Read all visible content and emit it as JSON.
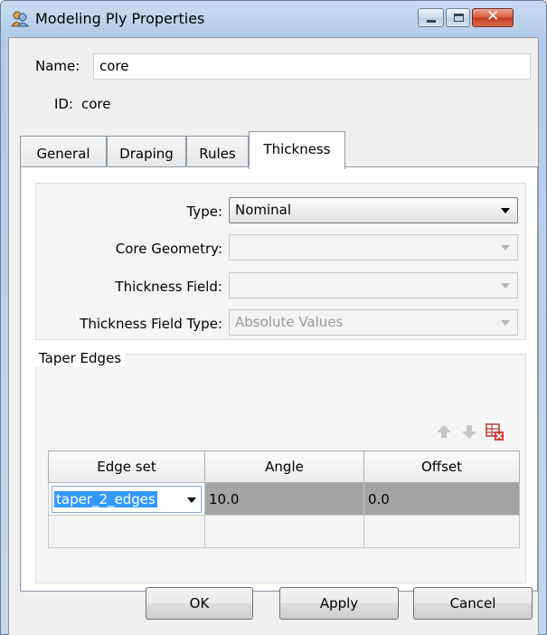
{
  "window": {
    "title": "Modeling Ply Properties"
  },
  "form": {
    "name_label": "Name:",
    "name_value": "core",
    "id_label": "ID:",
    "id_value": "core"
  },
  "tabs": [
    {
      "label": "General",
      "active": false
    },
    {
      "label": "Draping",
      "active": false
    },
    {
      "label": "Rules",
      "active": false
    },
    {
      "label": "Thickness",
      "active": true
    }
  ],
  "thickness": {
    "fields": [
      {
        "label": "Type:",
        "value": "Nominal",
        "enabled": true
      },
      {
        "label": "Core Geometry:",
        "value": "",
        "enabled": false
      },
      {
        "label": "Thickness Field:",
        "value": "",
        "enabled": false
      },
      {
        "label": "Thickness Field Type:",
        "value": "Absolute Values",
        "enabled": false
      }
    ]
  },
  "taper_edges": {
    "title": "Taper Edges",
    "toolbar_icons": [
      "move-up-icon",
      "move-down-icon",
      "delete-row-icon"
    ],
    "columns": [
      "Edge set",
      "Angle",
      "Offset"
    ],
    "rows": [
      {
        "edge_set": "taper_2_edges",
        "angle": "10.0",
        "offset": "0.0"
      }
    ]
  },
  "buttons": {
    "ok": "OK",
    "apply": "Apply",
    "cancel": "Cancel"
  },
  "colors": {
    "selection": "#3399ff",
    "selected_row": "#a4a4a4",
    "close_button": "#c13a1e"
  }
}
